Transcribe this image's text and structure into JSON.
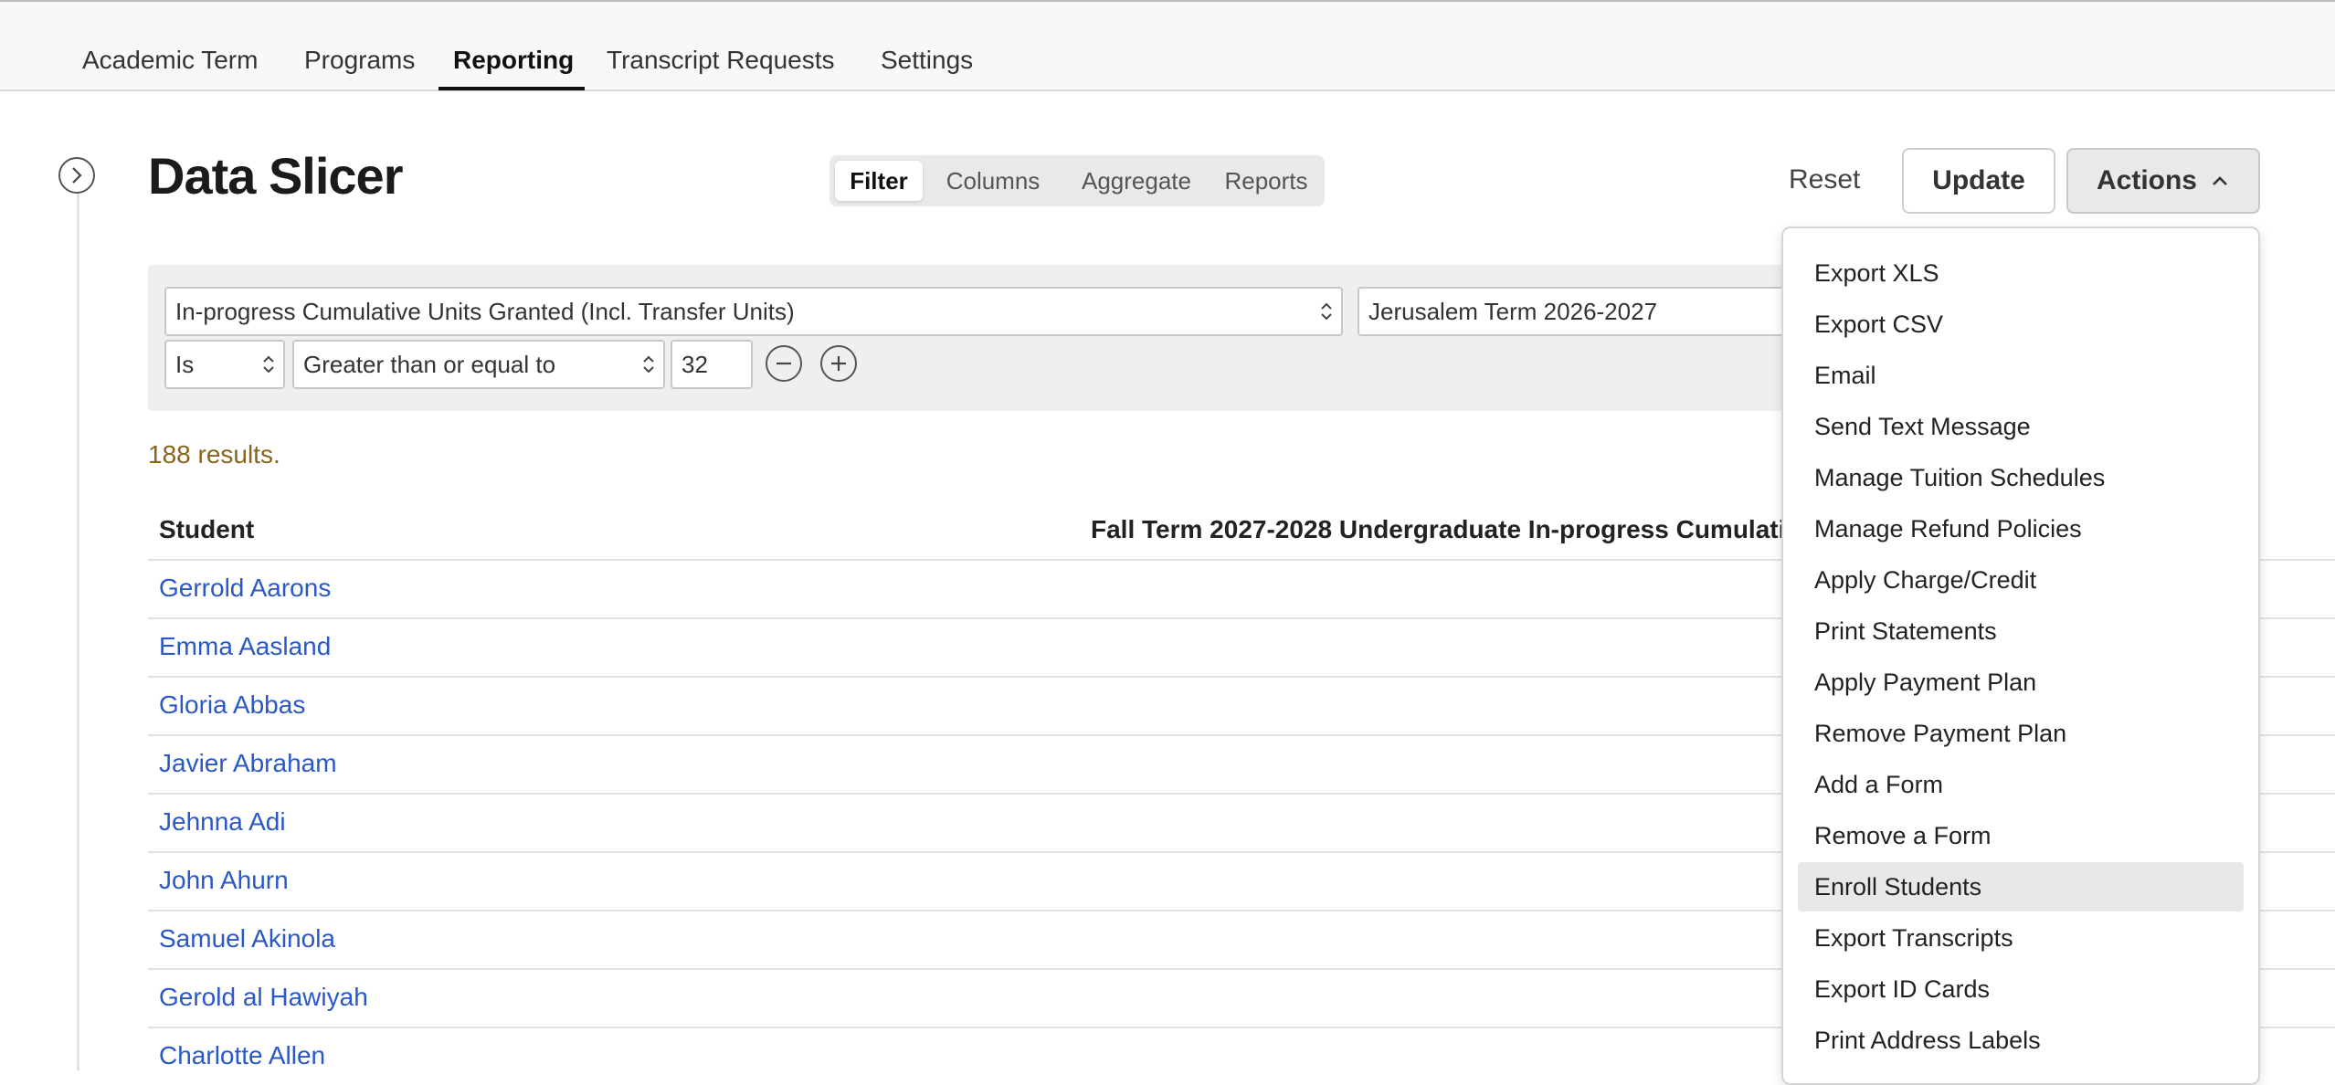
{
  "nav": {
    "tabs": [
      {
        "label": "Academic Term"
      },
      {
        "label": "Programs"
      },
      {
        "label": "Reporting"
      },
      {
        "label": "Transcript Requests"
      },
      {
        "label": "Settings"
      }
    ],
    "active_tab": "Reporting"
  },
  "page": {
    "title": "Data Slicer"
  },
  "view_tabs": [
    {
      "label": "Filter"
    },
    {
      "label": "Columns"
    },
    {
      "label": "Aggregate"
    },
    {
      "label": "Reports"
    }
  ],
  "toolbar": {
    "reset_label": "Reset",
    "update_label": "Update",
    "actions_label": "Actions"
  },
  "filter": {
    "field": "In-progress Cumulative Units Granted (Incl. Transfer Units)",
    "term": "Jerusalem Term 2026-2027",
    "is_select": "Is",
    "operator": "Greater than or equal to",
    "value": "32"
  },
  "results_text": "188 results.",
  "table": {
    "headers": {
      "student": "Student",
      "column": "Fall Term 2027-2028 Undergraduate In-progress Cumulati"
    },
    "rows": [
      {
        "student": "Gerrold Aarons"
      },
      {
        "student": "Emma Aasland"
      },
      {
        "student": "Gloria Abbas"
      },
      {
        "student": "Javier Abraham"
      },
      {
        "student": "Jehnna Adi"
      },
      {
        "student": "John Ahurn"
      },
      {
        "student": "Samuel Akinola"
      },
      {
        "student": "Gerold al Hawiyah"
      },
      {
        "student": "Charlotte Allen"
      }
    ]
  },
  "actions_menu": {
    "items": [
      {
        "label": "Export XLS"
      },
      {
        "label": "Export CSV"
      },
      {
        "label": "Email"
      },
      {
        "label": "Send Text Message"
      },
      {
        "label": "Manage Tuition Schedules"
      },
      {
        "label": "Manage Refund Policies"
      },
      {
        "label": "Apply Charge/Credit"
      },
      {
        "label": "Print Statements"
      },
      {
        "label": "Apply Payment Plan"
      },
      {
        "label": "Remove Payment Plan"
      },
      {
        "label": "Add a Form"
      },
      {
        "label": "Remove a Form"
      },
      {
        "label": "Enroll Students"
      },
      {
        "label": "Export Transcripts"
      },
      {
        "label": "Export ID Cards"
      },
      {
        "label": "Print Address Labels"
      }
    ],
    "highlighted": "Enroll Students"
  },
  "colors": {
    "link": "#2a58c8",
    "results": "#8a6418",
    "accent": "#111111"
  }
}
